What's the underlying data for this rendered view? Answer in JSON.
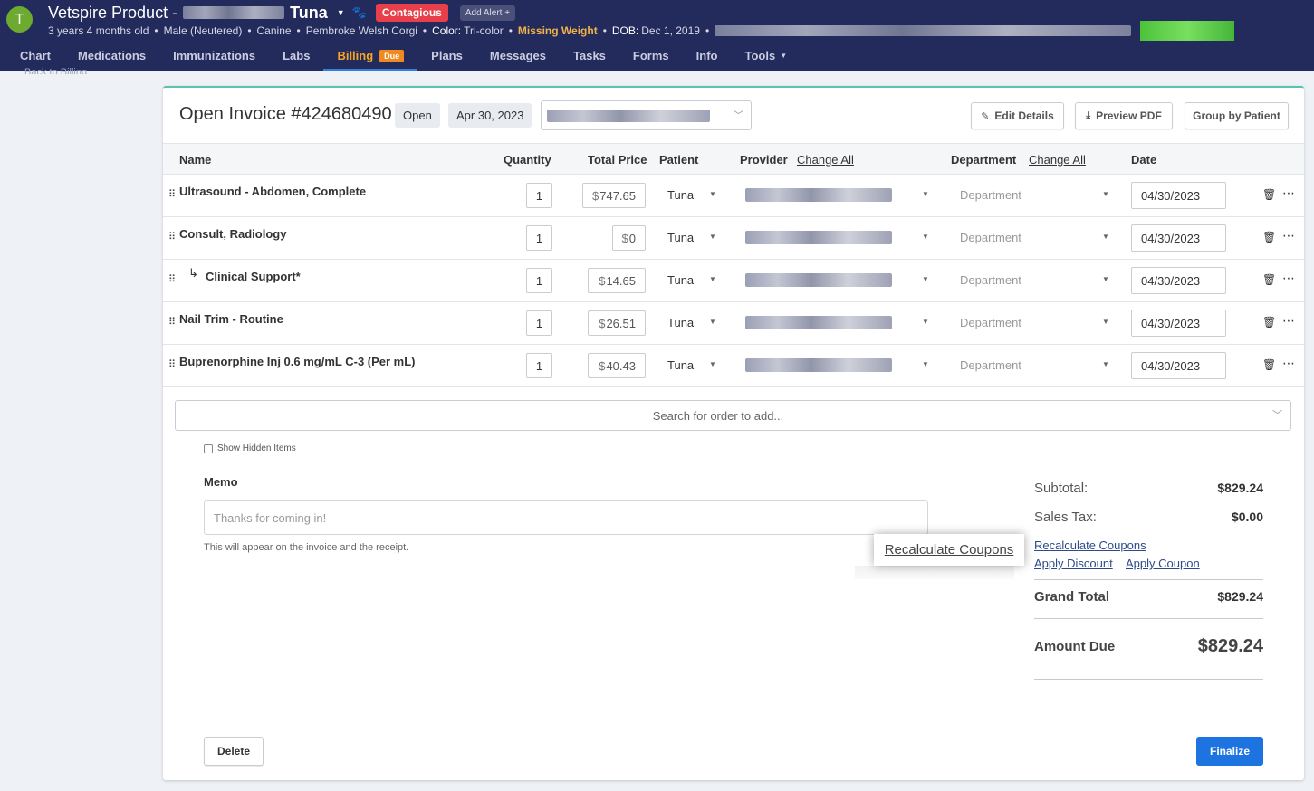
{
  "header": {
    "avatar_letter": "T",
    "product": "Vetspire Product -",
    "pet_name": "Tuna",
    "contagious_badge": "Contagious",
    "add_alert": "Add Alert +",
    "age": "3 years 4 months old",
    "sex": "Male (Neutered)",
    "species": "Canine",
    "breed": "Pembroke Welsh Corgi",
    "color_label": "Color:",
    "color_value": "Tri-color",
    "missing_weight": "Missing Weight",
    "dob_label": "DOB:",
    "dob_value": "Dec 1, 2019",
    "bullet": "•"
  },
  "nav": {
    "items": [
      "Chart",
      "Medications",
      "Immunizations",
      "Labs",
      "Billing",
      "Plans",
      "Messages",
      "Tasks",
      "Forms",
      "Info",
      "Tools"
    ],
    "active": "Billing",
    "billing_badge": "Due"
  },
  "back_link": "Back to Billing",
  "invoice": {
    "title": "Open Invoice #424680490",
    "status": "Open",
    "date": "Apr 30, 2023",
    "buttons": {
      "edit_details": "Edit Details",
      "preview_pdf": "Preview PDF",
      "group_by_patient": "Group by Patient"
    }
  },
  "table": {
    "headers": {
      "name": "Name",
      "quantity": "Quantity",
      "total_price": "Total Price",
      "patient": "Patient",
      "provider": "Provider",
      "department": "Department",
      "change_all": "Change All",
      "date": "Date"
    },
    "rows": [
      {
        "name": "Ultrasound - Abdomen, Complete",
        "qty": "1",
        "currency": "$",
        "price": "747.65",
        "patient": "Tuna",
        "department": "Department",
        "date": "04/30/2023",
        "child": false
      },
      {
        "name": "Consult, Radiology",
        "qty": "1",
        "currency": "$",
        "price": "0",
        "patient": "Tuna",
        "department": "Department",
        "date": "04/30/2023",
        "child": false
      },
      {
        "name": "Clinical Support*",
        "qty": "1",
        "currency": "$",
        "price": "14.65",
        "patient": "Tuna",
        "department": "Department",
        "date": "04/30/2023",
        "child": true
      },
      {
        "name": "Nail Trim - Routine",
        "qty": "1",
        "currency": "$",
        "price": "26.51",
        "patient": "Tuna",
        "department": "Department",
        "date": "04/30/2023",
        "child": false
      },
      {
        "name": "Buprenorphine Inj 0.6 mg/mL C-3 (Per mL)",
        "qty": "1",
        "currency": "$",
        "price": "40.43",
        "patient": "Tuna",
        "department": "Department",
        "date": "04/30/2023",
        "child": false
      }
    ]
  },
  "search": {
    "placeholder": "Search for order to add..."
  },
  "show_hidden": "Show Hidden Items",
  "memo": {
    "label": "Memo",
    "placeholder": "Thanks for coming in!",
    "help": "This will appear on the invoice and the receipt."
  },
  "tooltip": "Recalculate Coupons",
  "totals": {
    "subtotal_label": "Subtotal:",
    "subtotal": "$829.24",
    "tax_label": "Sales Tax:",
    "tax": "$0.00",
    "recalculate": "Recalculate Coupons",
    "apply_discount": "Apply Discount",
    "apply_coupon": "Apply Coupon",
    "grand_total_label": "Grand Total",
    "grand_total": "$829.24",
    "amount_due_label": "Amount Due",
    "amount_due": "$829.24"
  },
  "footer": {
    "delete": "Delete",
    "finalize": "Finalize"
  },
  "colors": {
    "header_bg": "#232a5c",
    "accent": "#1d74e0",
    "active_tab": "#f6a623",
    "contagious": "#e8404b",
    "warning": "#f0b448"
  }
}
